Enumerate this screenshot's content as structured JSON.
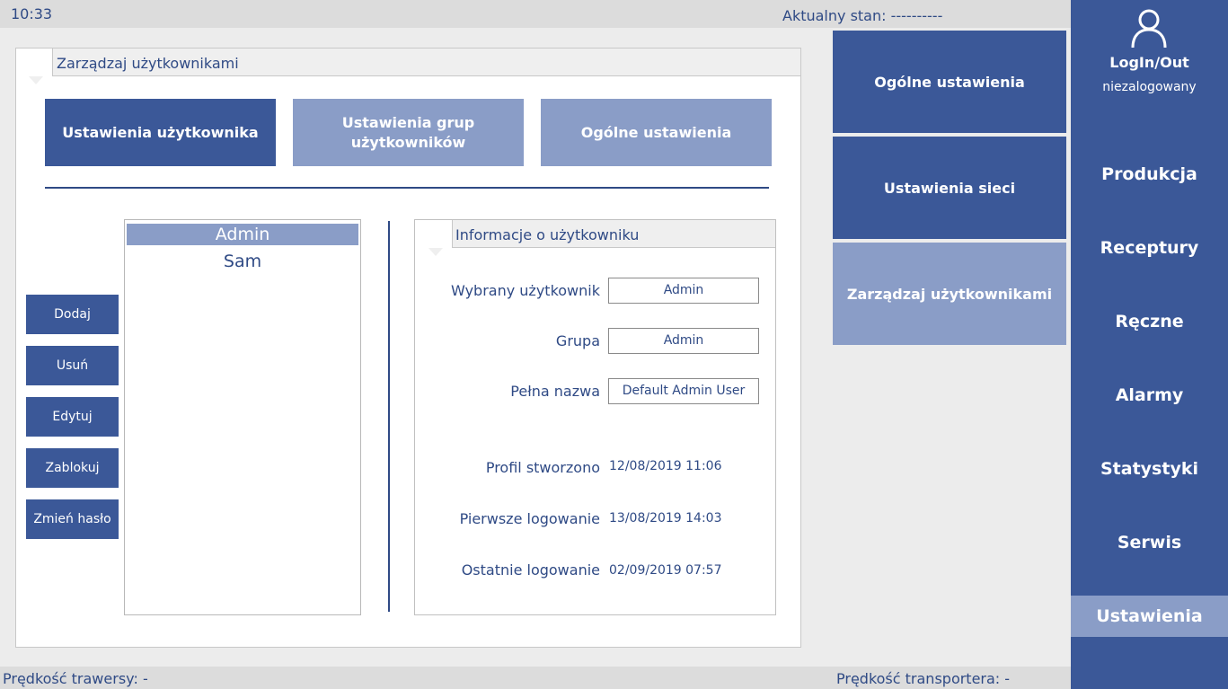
{
  "statusbar": {
    "time": "10:33",
    "status_label": "Aktualny stan:",
    "status_value": "----------"
  },
  "bottombar": {
    "traverse_speed_label": "Prędkość trawersy:",
    "traverse_speed_value": "-",
    "conveyor_speed_label": "Prędkość transportera:",
    "conveyor_speed_value": "-"
  },
  "main": {
    "title": "Zarządzaj użytkownikami",
    "tabs": [
      {
        "label": "Ustawienia użytkownika",
        "active": true
      },
      {
        "label": "Ustawienia grup użytkowników",
        "active": false
      },
      {
        "label": "Ogólne ustawienia",
        "active": false
      }
    ],
    "actions": {
      "add": "Dodaj",
      "remove": "Usuń",
      "edit": "Edytuj",
      "lock": "Zablokuj",
      "change_password": "Zmień hasło"
    },
    "users": [
      "Admin",
      "Sam"
    ],
    "selected_user": "Admin"
  },
  "info": {
    "title": "Informacje o użytkowniku",
    "selected_user_label": "Wybrany użytkownik",
    "selected_user_value": "Admin",
    "group_label": "Grupa",
    "group_value": "Admin",
    "full_name_label": "Pełna nazwa",
    "full_name_value": "Default Admin User",
    "created_label": "Profil stworzono",
    "created_value": "12/08/2019 11:06",
    "first_login_label": "Pierwsze logowanie",
    "first_login_value": "13/08/2019 14:03",
    "last_login_label": "Ostatnie logowanie",
    "last_login_value": "02/09/2019 07:57"
  },
  "submenu": {
    "items": [
      {
        "label": "Ogólne ustawienia",
        "active": false
      },
      {
        "label": "Ustawienia sieci",
        "active": false
      },
      {
        "label": "Zarządzaj użytkownikami",
        "active": true
      }
    ]
  },
  "nav": {
    "login_icon": "user-icon",
    "login_label": "LogIn/Out",
    "login_status": "niezalogowany",
    "items": [
      {
        "label": "Produkcja"
      },
      {
        "label": "Receptury"
      },
      {
        "label": "Ręczne"
      },
      {
        "label": "Alarmy"
      },
      {
        "label": "Statystyki"
      },
      {
        "label": "Serwis"
      },
      {
        "label": "Ustawienia",
        "active": true
      }
    ]
  },
  "colors": {
    "primary": "#3b5898",
    "primary_light": "#8a9dc7",
    "text": "#2f4a85",
    "background": "#ececec"
  }
}
